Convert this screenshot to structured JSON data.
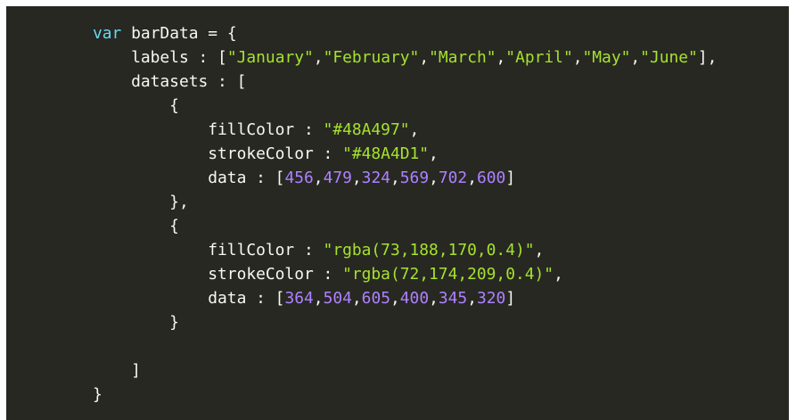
{
  "code": {
    "keyword_var": "var",
    "var_name": "barData",
    "labels_key": "labels",
    "labels": [
      "January",
      "February",
      "March",
      "April",
      "May",
      "June"
    ],
    "datasets_key": "datasets",
    "fill_key": "fillColor",
    "stroke_key": "strokeColor",
    "data_key": "data",
    "datasets": [
      {
        "fillColor": "#48A497",
        "strokeColor": "#48A4D1",
        "data": [
          "456",
          "479",
          "324",
          "569",
          "702",
          "600"
        ]
      },
      {
        "fillColor": "rgba(73,188,170,0.4)",
        "strokeColor": "rgba(72,174,209,0.4)",
        "data": [
          "364",
          "504",
          "605",
          "400",
          "345",
          "320"
        ]
      }
    ]
  },
  "colors": {
    "background": "#272822",
    "keyword": "#66d9ef",
    "string": "#a6e22e",
    "number": "#ae81ff",
    "text": "#f8f8f2"
  }
}
